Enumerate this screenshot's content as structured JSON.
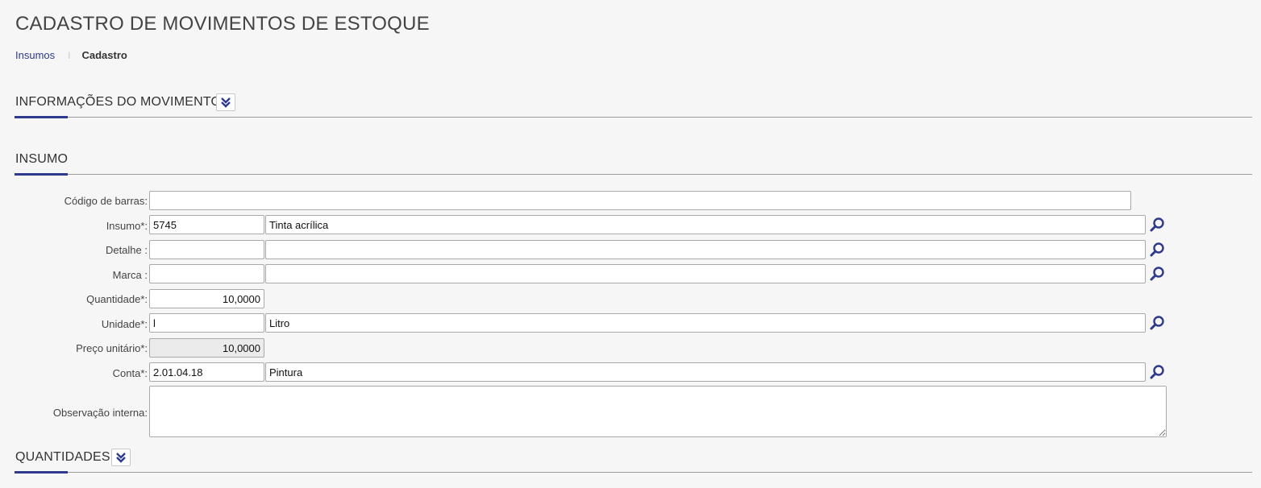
{
  "page": {
    "title": "CADASTRO DE MOVIMENTOS DE ESTOQUE"
  },
  "breadcrumb": {
    "items": [
      "Insumos",
      "Cadastro"
    ],
    "separator": "I"
  },
  "sections": {
    "info": {
      "title": "INFORMAÇÕES DO MOVIMENTO"
    },
    "insumo": {
      "title": "INSUMO"
    },
    "quantidades": {
      "title": "QUANTIDADES"
    }
  },
  "form": {
    "barcode": {
      "label": "Código de barras:",
      "value": ""
    },
    "insumo": {
      "label": "Insumo*:",
      "code": "5745",
      "description": "Tinta acrílica"
    },
    "detalhe": {
      "label": "Detalhe :",
      "code": "",
      "description": ""
    },
    "marca": {
      "label": "Marca :",
      "code": "",
      "description": ""
    },
    "quantidade": {
      "label": "Quantidade*:",
      "value": "10,0000"
    },
    "unidade": {
      "label": "Unidade*:",
      "code": "l",
      "description": "Litro"
    },
    "preco": {
      "label": "Preço unitário*:",
      "value": "10,0000"
    },
    "conta": {
      "label": "Conta*:",
      "code": "2.01.04.18",
      "description": "Pintura"
    },
    "observacao": {
      "label": "Observação interna:",
      "value": ""
    }
  },
  "colors": {
    "accent": "#2e3a8c",
    "background": "#f6f6f6",
    "disabled_input": "#ebebeb"
  },
  "icons": {
    "collapse": "double-chevron-down-icon",
    "lookup": "magnifier-icon"
  }
}
